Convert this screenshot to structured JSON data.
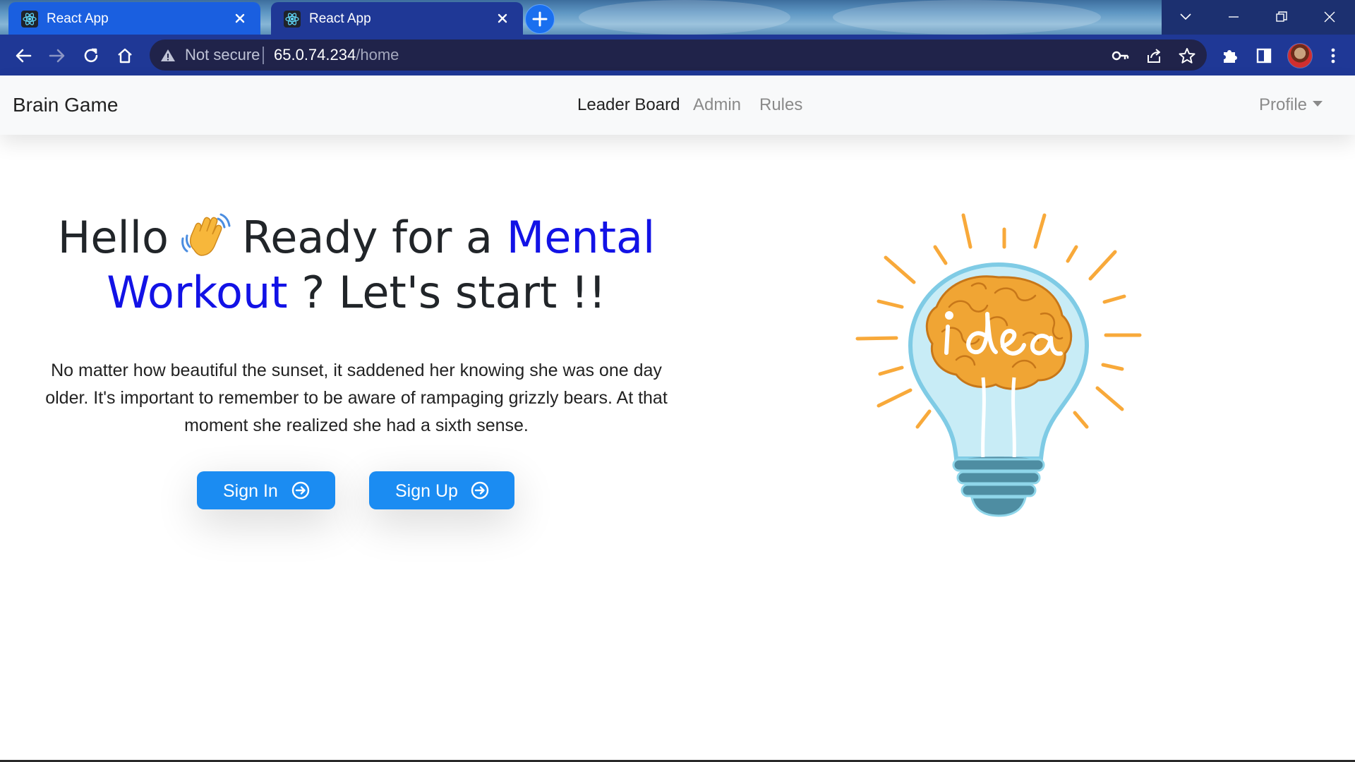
{
  "browser": {
    "tabs": [
      {
        "title": "React App",
        "active": false
      },
      {
        "title": "React App",
        "active": true
      }
    ],
    "address": {
      "security_label": "Not secure",
      "host": "65.0.74.234",
      "path": "/home"
    }
  },
  "navbar": {
    "brand": "Brain Game",
    "links": [
      "Leader Board",
      "Admin",
      "Rules"
    ],
    "profile_label": "Profile"
  },
  "hero": {
    "title_part1": "Hello",
    "title_part2": "Ready for a",
    "title_highlight1": "Mental",
    "title_highlight2": "Workout",
    "title_part3": "? Let's start !!",
    "body": "No matter how beautiful the sunset, it saddened her knowing she was one day older. It's important to remember to be aware of rampaging grizzly bears. At that moment she realized she had a sixth sense.",
    "signin_label": "Sign In",
    "signup_label": "Sign Up",
    "illustration_text": "idea"
  },
  "colors": {
    "primary_button": "#1b8cf2",
    "highlight_text": "#1212e6",
    "tab_active": "#1f3896",
    "tab_inactive": "#1a5fe0"
  },
  "icons": [
    "react-favicon-icon",
    "close-icon",
    "plus-icon",
    "back-icon",
    "forward-icon",
    "reload-icon",
    "home-icon",
    "warning-icon",
    "key-icon",
    "share-icon",
    "star-icon",
    "extensions-icon",
    "side-panel-icon",
    "menu-icon",
    "waving-hand-icon",
    "arrow-right-circle-icon",
    "lightbulb-brain-illustration"
  ]
}
